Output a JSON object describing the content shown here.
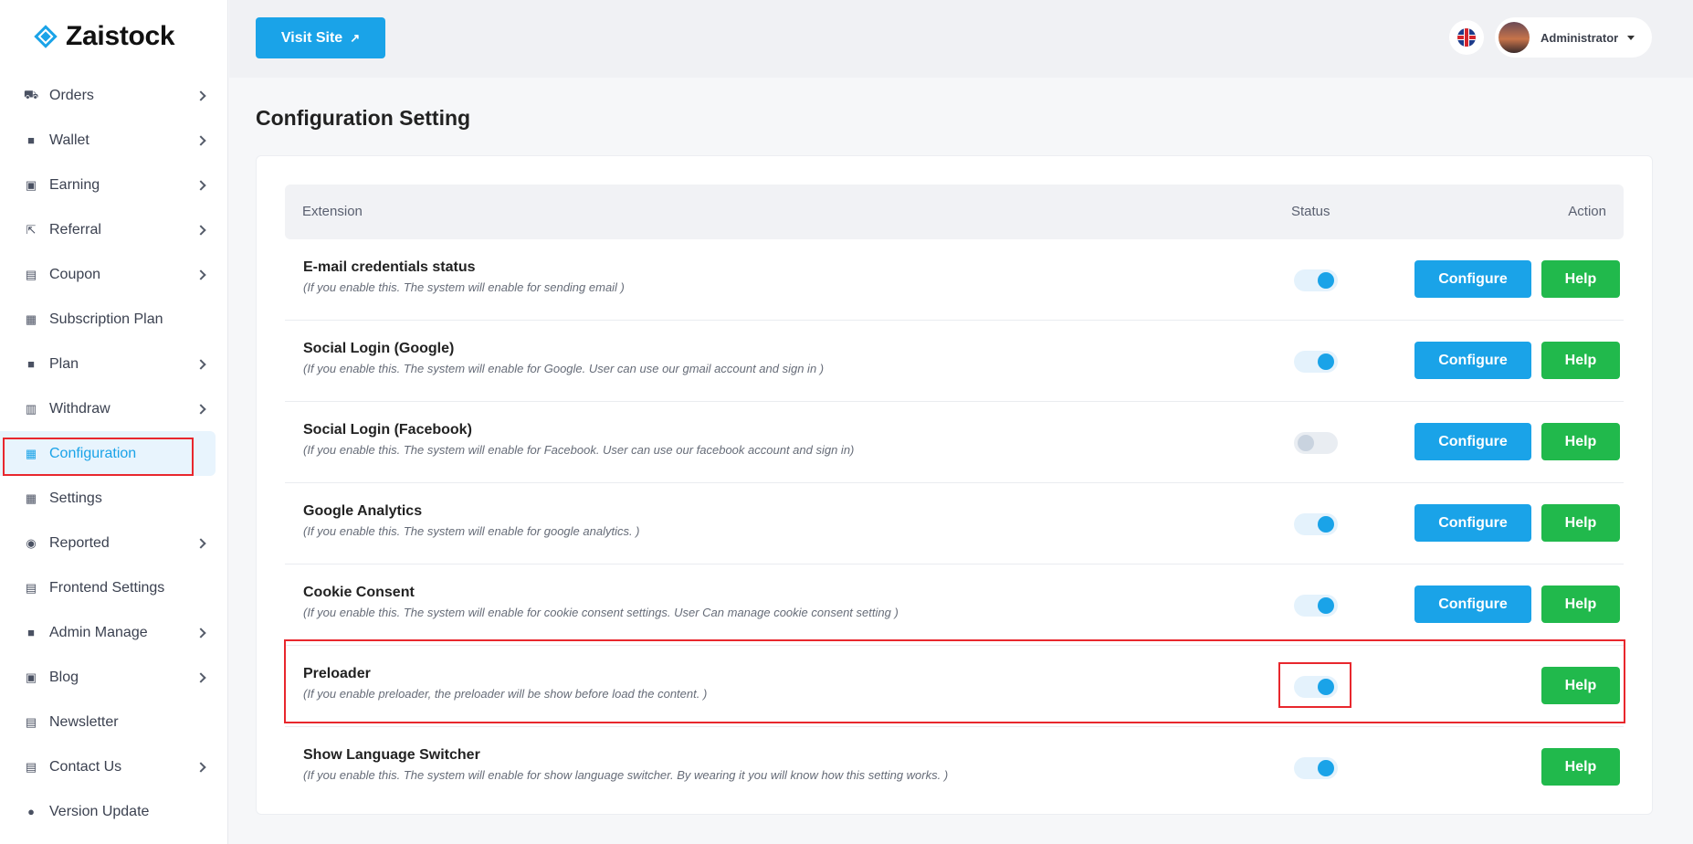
{
  "brand": {
    "name": "Zaistock"
  },
  "sidebar": {
    "items": [
      {
        "label": "Orders",
        "icon": "cart-icon",
        "glyph": "⛟",
        "chevron": true
      },
      {
        "label": "Wallet",
        "icon": "wallet-icon",
        "glyph": "■",
        "chevron": true
      },
      {
        "label": "Earning",
        "icon": "money-icon",
        "glyph": "▣",
        "chevron": true
      },
      {
        "label": "Referral",
        "icon": "share-icon",
        "glyph": "⇱",
        "chevron": true
      },
      {
        "label": "Coupon",
        "icon": "ticket-icon",
        "glyph": "▤",
        "chevron": true
      },
      {
        "label": "Subscription Plan",
        "icon": "box-icon",
        "glyph": "▦",
        "chevron": false
      },
      {
        "label": "Plan",
        "icon": "calendar-icon",
        "glyph": "■",
        "chevron": true
      },
      {
        "label": "Withdraw",
        "icon": "atm-icon",
        "glyph": "▥",
        "chevron": true
      },
      {
        "label": "Configuration",
        "icon": "config-icon",
        "glyph": "▦",
        "chevron": false,
        "active": true
      },
      {
        "label": "Settings",
        "icon": "settings-icon",
        "glyph": "▦",
        "chevron": false
      },
      {
        "label": "Reported",
        "icon": "alert-icon",
        "glyph": "◉",
        "chevron": true
      },
      {
        "label": "Frontend Settings",
        "icon": "layout-icon",
        "glyph": "▤",
        "chevron": false
      },
      {
        "label": "Admin Manage",
        "icon": "admin-icon",
        "glyph": "■",
        "chevron": true
      },
      {
        "label": "Blog",
        "icon": "blog-icon",
        "glyph": "▣",
        "chevron": true
      },
      {
        "label": "Newsletter",
        "icon": "newsletter-icon",
        "glyph": "▤",
        "chevron": false
      },
      {
        "label": "Contact Us",
        "icon": "contact-icon",
        "glyph": "▤",
        "chevron": true
      },
      {
        "label": "Version Update",
        "icon": "update-icon",
        "glyph": "●",
        "chevron": false
      }
    ]
  },
  "topbar": {
    "visit_label": "Visit Site",
    "visit_icon": "↗",
    "user_name": "Administrator"
  },
  "page": {
    "title": "Configuration Setting"
  },
  "table": {
    "headers": {
      "extension": "Extension",
      "status": "Status",
      "action": "Action"
    },
    "configure_label": "Configure",
    "help_label": "Help",
    "rows": [
      {
        "title": "E-mail credentials status",
        "desc": "(If you enable this. The system will enable for sending email )",
        "enabled": true,
        "configurable": true
      },
      {
        "title": "Social Login (Google)",
        "desc": "(If you enable this. The system will enable for Google. User can use our gmail account and sign in )",
        "enabled": true,
        "configurable": true
      },
      {
        "title": "Social Login (Facebook)",
        "desc": "(If you enable this. The system will enable for Facebook. User can use our facebook account and sign in)",
        "enabled": false,
        "configurable": true
      },
      {
        "title": "Google Analytics",
        "desc": "(If you enable this. The system will enable for google analytics. )",
        "enabled": true,
        "configurable": true
      },
      {
        "title": "Cookie Consent",
        "desc": "(If you enable this. The system will enable for cookie consent settings. User Can manage cookie consent setting )",
        "enabled": true,
        "configurable": true
      },
      {
        "title": "Preloader",
        "desc": "(If you enable preloader, the preloader will be show before load the content. )",
        "enabled": true,
        "configurable": false
      },
      {
        "title": "Show Language Switcher",
        "desc": "(If you enable this. The system will enable for show language switcher. By wearing it you will know how this setting works. )",
        "enabled": true,
        "configurable": false
      }
    ]
  },
  "colors": {
    "accent": "#1aa3e8",
    "help": "#21b94c",
    "highlight": "#e8272d"
  }
}
